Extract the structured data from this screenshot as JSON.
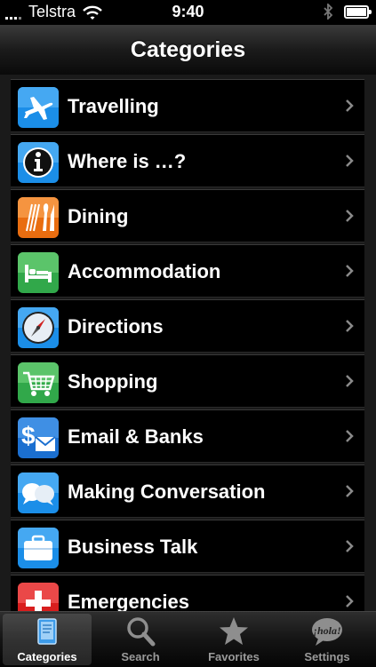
{
  "status_bar": {
    "carrier": "Telstra",
    "time": "9:40",
    "battery_level": 0.9
  },
  "nav": {
    "title": "Categories"
  },
  "categories": [
    {
      "label": "Travelling",
      "icon": "airplane-icon"
    },
    {
      "label": "Where is …?",
      "icon": "info-icon"
    },
    {
      "label": "Dining",
      "icon": "fork-knife-icon"
    },
    {
      "label": "Accommodation",
      "icon": "bed-icon"
    },
    {
      "label": "Directions",
      "icon": "compass-icon"
    },
    {
      "label": "Shopping",
      "icon": "shopping-cart-icon"
    },
    {
      "label": "Email & Banks",
      "icon": "dollar-envelope-icon"
    },
    {
      "label": "Making Conversation",
      "icon": "speech-bubbles-icon"
    },
    {
      "label": "Business Talk",
      "icon": "briefcase-icon"
    },
    {
      "label": "Emergencies",
      "icon": "swiss-cross-icon"
    }
  ],
  "tabs": [
    {
      "label": "Categories",
      "icon": "book-icon",
      "active": true
    },
    {
      "label": "Search",
      "icon": "magnifier-icon",
      "active": false
    },
    {
      "label": "Favorites",
      "icon": "star-icon",
      "active": false
    },
    {
      "label": "Settings",
      "icon": "hola-bubble-icon",
      "active": false
    }
  ],
  "hola_text": "¡hola!"
}
